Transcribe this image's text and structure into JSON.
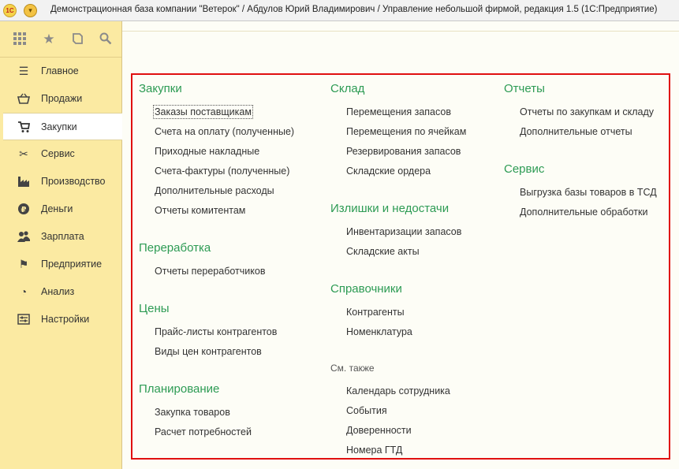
{
  "window": {
    "title": "Демонстрационная база компании \"Ветерок\" / Абдулов Юрий Владимирович / Управление небольшой фирмой, редакция 1.5  (1С:Предприятие)",
    "logo_text": "1С"
  },
  "quickbar": {
    "icons": [
      "apps-grid-icon",
      "star-icon",
      "history-icon",
      "search-icon"
    ]
  },
  "sidebar": {
    "items": [
      {
        "label": "Главное",
        "icon": "menu-lines-icon"
      },
      {
        "label": "Продажи",
        "icon": "basket-icon"
      },
      {
        "label": "Закупки",
        "icon": "cart-icon",
        "active": true
      },
      {
        "label": "Сервис",
        "icon": "tools-icon"
      },
      {
        "label": "Производство",
        "icon": "factory-icon"
      },
      {
        "label": "Деньги",
        "icon": "ruble-icon"
      },
      {
        "label": "Зарплата",
        "icon": "people-icon"
      },
      {
        "label": "Предприятие",
        "icon": "flag-icon"
      },
      {
        "label": "Анализ",
        "icon": "pie-chart-icon"
      },
      {
        "label": "Настройки",
        "icon": "settings-icon"
      }
    ]
  },
  "content": {
    "col1": {
      "purchases": {
        "title": "Закупки",
        "links": [
          "Заказы поставщикам",
          "Счета на оплату (полученные)",
          "Приходные накладные",
          "Счета-фактуры (полученные)",
          "Дополнительные расходы",
          "Отчеты комитентам"
        ]
      },
      "processing": {
        "title": "Переработка",
        "links": [
          "Отчеты переработчиков"
        ]
      },
      "prices": {
        "title": "Цены",
        "links": [
          "Прайс-листы контрагентов",
          "Виды цен контрагентов"
        ]
      },
      "planning": {
        "title": "Планирование",
        "links": [
          "Закупка товаров",
          "Расчет потребностей"
        ]
      }
    },
    "col2": {
      "warehouse": {
        "title": "Склад",
        "links": [
          "Перемещения запасов",
          "Перемещения по ячейкам",
          "Резервирования запасов",
          "Складские ордера"
        ]
      },
      "surplus": {
        "title": "Излишки и недостачи",
        "links": [
          "Инвентаризации запасов",
          "Складские акты"
        ]
      },
      "references": {
        "title": "Справочники",
        "links": [
          "Контрагенты",
          "Номенклатура"
        ]
      },
      "see_also": {
        "title": "См. также",
        "links": [
          "Календарь сотрудника",
          "События",
          "Доверенности",
          "Номера ГТД"
        ]
      }
    },
    "col3": {
      "reports": {
        "title": "Отчеты",
        "links": [
          "Отчеты по закупкам и складу",
          "Дополнительные отчеты"
        ]
      },
      "service": {
        "title": "Сервис",
        "links": [
          "Выгрузка базы товаров в ТСД",
          "Дополнительные обработки"
        ]
      }
    }
  },
  "colors": {
    "section_title": "#2d9b54",
    "sidebar_bg": "#fbeaa2",
    "highlight_frame": "#e01010"
  }
}
